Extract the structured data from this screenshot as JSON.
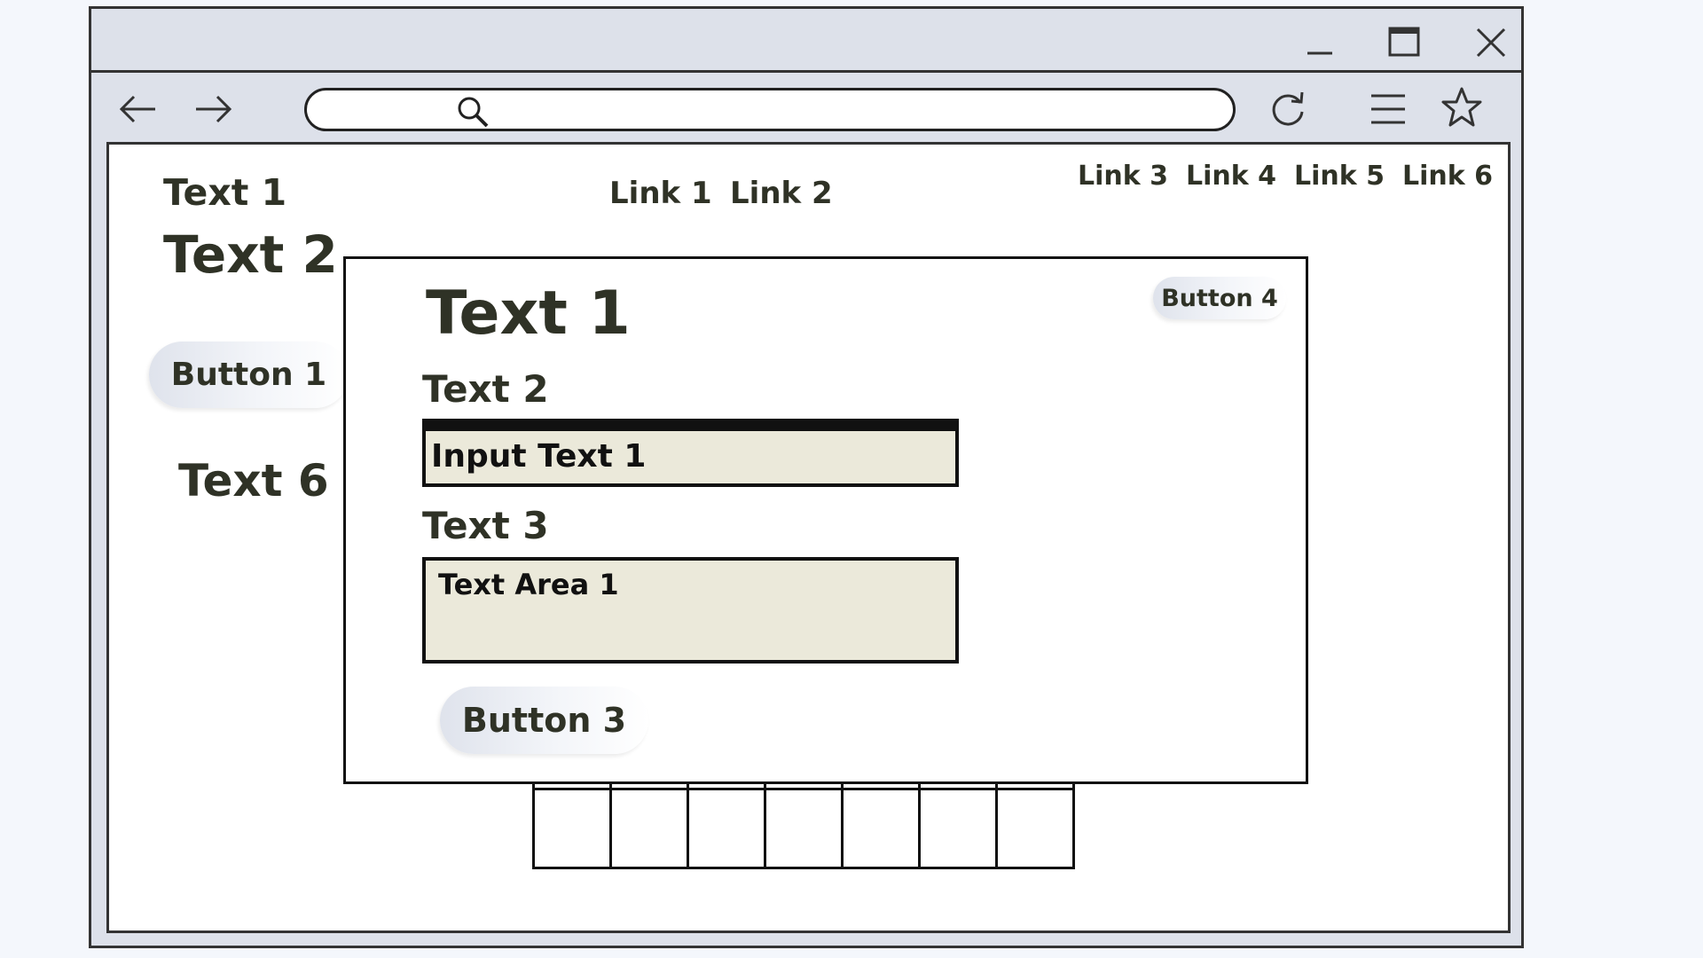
{
  "page": {
    "header": {
      "text1": "Text 1",
      "text2": "Text 2",
      "nav_center": [
        "Link 1",
        "Link 2"
      ],
      "nav_right": [
        "Link 3",
        "Link 4",
        "Link 5",
        "Link 6"
      ]
    },
    "sidebar": {
      "button1": "Button 1",
      "text6": "Text 6"
    },
    "address_bar": {
      "value": ""
    }
  },
  "modal": {
    "title": "Text 1",
    "label_input": "Text 2",
    "input_value": "Input Text 1",
    "label_textarea": "Text 3",
    "textarea_value": "Text Area 1",
    "primary_button": "Button 3",
    "corner_button": "Button 4"
  },
  "icons": {
    "minimize": "minimize-icon",
    "maximize": "maximize-icon",
    "close": "close-icon",
    "back": "arrow-left-icon",
    "forward": "arrow-right-icon",
    "search": "search-icon",
    "reload": "reload-icon",
    "menu": "hamburger-menu-icon",
    "bookmark": "star-icon"
  },
  "colors": {
    "chrome": "#dde1ea",
    "text": "#2f3226",
    "field": "#ebe9da"
  }
}
